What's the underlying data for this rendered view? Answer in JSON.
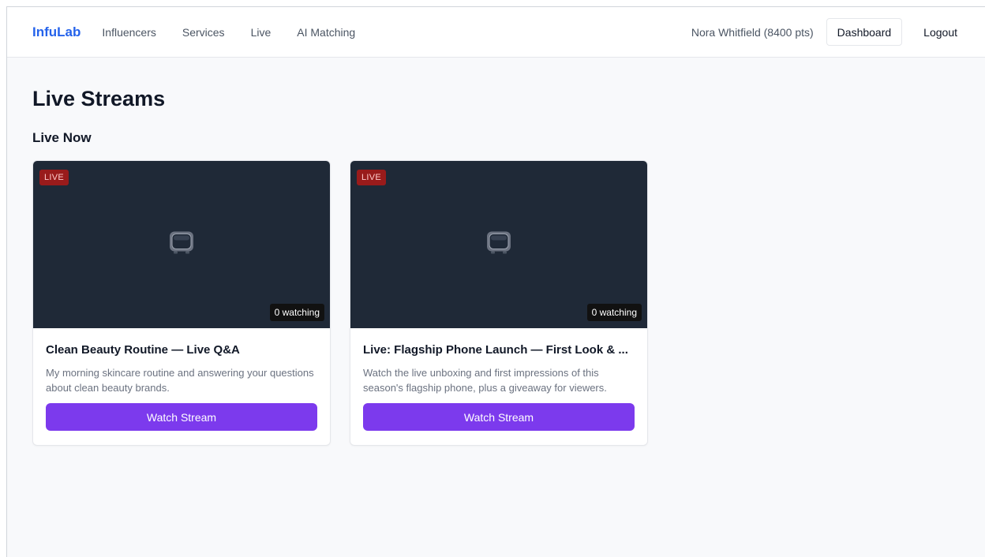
{
  "nav": {
    "brand": "InfuLab",
    "links": [
      "Influencers",
      "Services",
      "Live",
      "AI Matching"
    ],
    "user": "Nora Whitfield (8400 pts)",
    "dashboard_label": "Dashboard",
    "logout_label": "Logout"
  },
  "page": {
    "title": "Live Streams",
    "section_title": "Live Now"
  },
  "streams": [
    {
      "badge": "LIVE",
      "watching": "0 watching",
      "title": "Clean Beauty Routine — Live Q&A",
      "description": "My morning skincare routine and answering your questions about clean beauty brands.",
      "button": "Watch Stream"
    },
    {
      "badge": "LIVE",
      "watching": "0 watching",
      "title": "Live: Flagship Phone Launch — First Look & ...",
      "description": "Watch the live unboxing and first impressions of this season's flagship phone, plus a giveaway for viewers.",
      "button": "Watch Stream"
    }
  ],
  "colors": {
    "brand": "#2563eb",
    "accent": "#7c3aed",
    "live_badge": "#991b1b",
    "thumbnail_bg": "#1f2937"
  },
  "icons": {
    "thumbnail": "television-icon"
  }
}
